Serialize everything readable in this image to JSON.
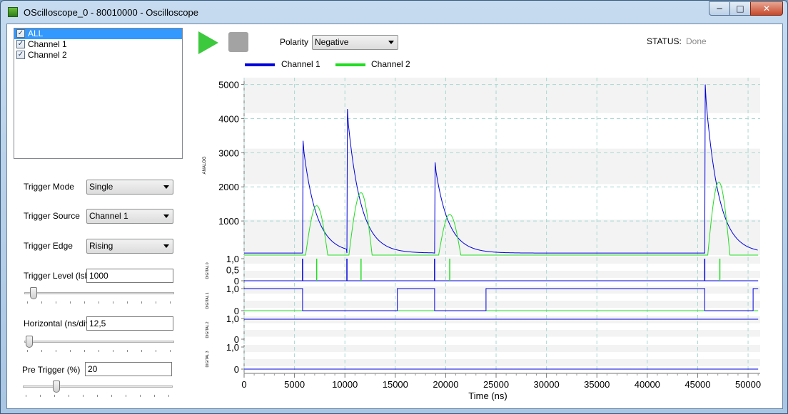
{
  "window": {
    "title": "OScilloscope_0 - 80010000 - Oscilloscope",
    "min_icon": "minimize-icon",
    "max_icon": "maximize-icon",
    "close_icon": "close-icon"
  },
  "channels": [
    {
      "label": "ALL",
      "checked": true,
      "selected": true
    },
    {
      "label": "Channel 1",
      "checked": true,
      "selected": false
    },
    {
      "label": "Channel 2",
      "checked": true,
      "selected": false
    }
  ],
  "controls": {
    "trigger_mode_label": "Trigger Mode",
    "trigger_mode_value": "Single",
    "trigger_source_label": "Trigger Source",
    "trigger_source_value": "Channel 1",
    "trigger_edge_label": "Trigger Edge",
    "trigger_edge_value": "Rising",
    "trigger_level_label": "Trigger Level (lsb)",
    "trigger_level_value": "1000",
    "trigger_level_slider": 0.03,
    "horizontal_label": "Horizontal (ns/div)",
    "horizontal_value": "12,5",
    "horizontal_slider": 0.0,
    "pretrigger_label": "Pre Trigger (%)",
    "pretrigger_value": "20",
    "pretrigger_slider": 0.2
  },
  "toolbar": {
    "play_icon": "play-icon",
    "stop_icon": "stop-icon",
    "polarity_label": "Polarity",
    "polarity_value": "Negative",
    "status_label": "STATUS:",
    "status_value": "Done"
  },
  "colors": {
    "channel1": "#0000dd",
    "channel2": "#22dd22"
  },
  "chart_data": {
    "type": "line",
    "xlabel": "Time (ns)",
    "xlim": [
      0,
      51200
    ],
    "x_ticks": [
      "0",
      "5000",
      "10000",
      "15000",
      "20000",
      "25000",
      "30000",
      "35000",
      "40000",
      "45000",
      "50000"
    ],
    "legend": [
      {
        "name": "Channel 1",
        "color": "#0000dd"
      },
      {
        "name": "Channel 2",
        "color": "#22dd22"
      }
    ],
    "legend_position": "top-left",
    "grid": true,
    "analog": {
      "axis_label": "ANALOG",
      "ylim": [
        0,
        5200
      ],
      "y_ticks": [
        "5000",
        "4000",
        "3000",
        "2000",
        "1000"
      ],
      "channel1_pulses": [
        {
          "t": 5800,
          "peak": 3350
        },
        {
          "t": 10200,
          "peak": 4280
        },
        {
          "t": 18900,
          "peak": 2720
        },
        {
          "t": 45700,
          "peak": 5000
        }
      ],
      "channel1_baseline": 60,
      "channel2_pulses": [
        {
          "start": 6100,
          "peak_t": 7200,
          "end": 8300,
          "peak": 1450
        },
        {
          "start": 10400,
          "peak_t": 11600,
          "end": 12700,
          "peak": 1830
        },
        {
          "start": 19300,
          "peak_t": 20400,
          "end": 21500,
          "peak": 1190
        },
        {
          "start": 46000,
          "peak_t": 47100,
          "end": 48200,
          "peak": 2140
        }
      ],
      "channel2_end": 51000
    },
    "digital": [
      {
        "axis_label": "DIGITAL 0",
        "y_ticks": [
          "1,0",
          "0,5",
          "0"
        ],
        "channel1_spikes": [
          5800,
          10200,
          18900,
          45700
        ],
        "channel2_spikes": [
          7200,
          11600,
          20400,
          47200
        ]
      },
      {
        "axis_label": "DIGITAL 1",
        "y_ticks": [
          "1,0",
          "0"
        ],
        "channel1_high": [
          [
            0,
            5800
          ],
          [
            15200,
            18900
          ],
          [
            24000,
            45700
          ],
          [
            50500,
            51000
          ]
        ],
        "channel2_level": 0
      },
      {
        "axis_label": "DIGITAL 2",
        "y_ticks": [
          "1,0",
          "0"
        ],
        "channel1_level": 1
      },
      {
        "axis_label": "DIGITAL 3",
        "y_ticks": [
          "1,0",
          "0"
        ],
        "channel1_level": 0
      }
    ]
  }
}
